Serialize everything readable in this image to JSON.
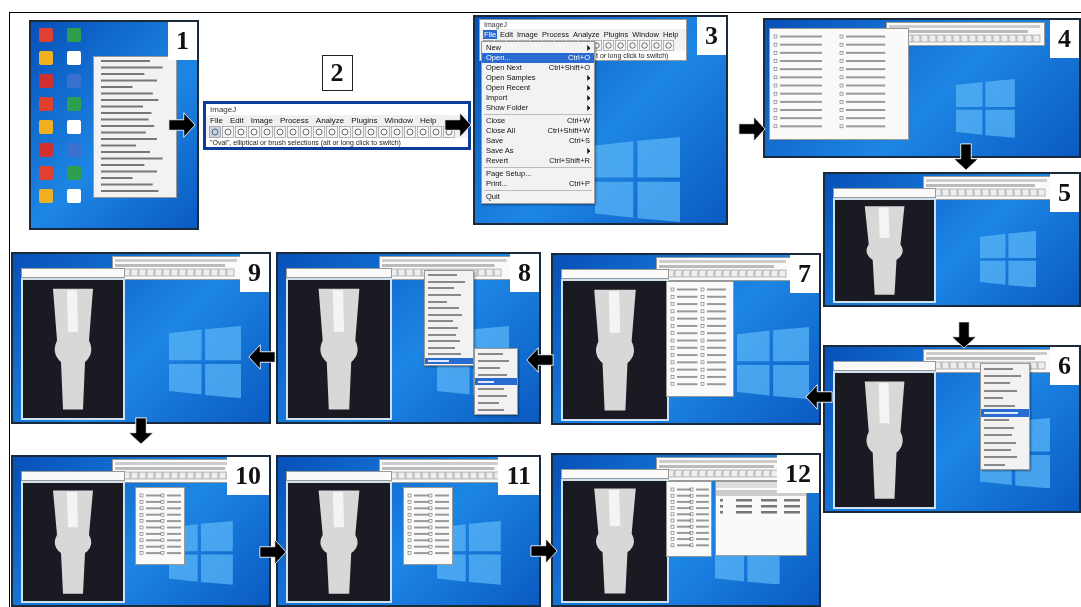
{
  "panels": [
    {
      "number": "1",
      "kind": "context-menu"
    },
    {
      "number": "2",
      "kind": "toolbar",
      "title": "ImageJ",
      "menubar": [
        {
          "label": "File",
          "selected": false
        },
        {
          "label": "Edit",
          "selected": false
        },
        {
          "label": "Image",
          "selected": false
        },
        {
          "label": "Process",
          "selected": false
        },
        {
          "label": "Analyze",
          "selected": false
        },
        {
          "label": "Plugins",
          "selected": false
        },
        {
          "label": "Window",
          "selected": false
        },
        {
          "label": "Help",
          "selected": false
        }
      ],
      "status": "\"Oval\", elliptical or brush selections (alt or long click to switch)"
    },
    {
      "number": "3",
      "kind": "file-menu",
      "title": "ImageJ",
      "menubar": [
        {
          "label": "File",
          "selected": true
        },
        {
          "label": "Edit",
          "selected": false
        },
        {
          "label": "Image",
          "selected": false
        },
        {
          "label": "Process",
          "selected": false
        },
        {
          "label": "Analyze",
          "selected": false
        },
        {
          "label": "Plugins",
          "selected": false
        },
        {
          "label": "Window",
          "selected": false
        },
        {
          "label": "Help",
          "selected": false
        }
      ],
      "status": "t or long click to switch)",
      "menu": [
        {
          "kind": "item",
          "label": "New",
          "submenu": true,
          "selected": false
        },
        {
          "kind": "item",
          "label": "Open...",
          "shortcut": "Ctrl+O",
          "selected": true
        },
        {
          "kind": "item",
          "label": "Open Next",
          "shortcut": "Ctrl+Shift+O",
          "selected": false
        },
        {
          "kind": "item",
          "label": "Open Samples",
          "submenu": true,
          "selected": false
        },
        {
          "kind": "item",
          "label": "Open Recent",
          "submenu": true,
          "selected": false
        },
        {
          "kind": "item",
          "label": "Import",
          "submenu": true,
          "selected": false
        },
        {
          "kind": "item",
          "label": "Show Folder",
          "submenu": true,
          "selected": false
        },
        {
          "kind": "separator"
        },
        {
          "kind": "item",
          "label": "Close",
          "shortcut": "Ctrl+W",
          "selected": false
        },
        {
          "kind": "item",
          "label": "Close All",
          "shortcut": "Ctrl+Shift+W",
          "selected": false
        },
        {
          "kind": "item",
          "label": "Save",
          "shortcut": "Ctrl+S",
          "selected": false
        },
        {
          "kind": "item",
          "label": "Save As",
          "submenu": true,
          "selected": false
        },
        {
          "kind": "item",
          "label": "Revert",
          "shortcut": "Ctrl+Shift+R",
          "selected": false
        },
        {
          "kind": "separator"
        },
        {
          "kind": "item",
          "label": "Page Setup...",
          "selected": false
        },
        {
          "kind": "item",
          "label": "Print...",
          "shortcut": "Ctrl+P",
          "selected": false
        },
        {
          "kind": "separator"
        },
        {
          "kind": "item",
          "label": "Quit",
          "selected": false
        }
      ]
    },
    {
      "number": "4",
      "kind": "open-dialog"
    },
    {
      "number": "5",
      "kind": "image-window"
    },
    {
      "number": "9",
      "kind": "image-window"
    },
    {
      "number": "8",
      "kind": "analyze-menu",
      "menu_rows": [
        {
          "selected": false
        },
        {
          "selected": false
        },
        {
          "selected": false
        },
        {
          "selected": false
        },
        {
          "selected": false
        },
        {
          "selected": false
        },
        {
          "selected": false
        },
        {
          "selected": false
        },
        {
          "selected": false
        },
        {
          "selected": false
        },
        {
          "selected": false
        },
        {
          "selected": false
        },
        {
          "selected": false
        },
        {
          "selected": true
        }
      ],
      "submenu_rows": [
        {
          "selected": false
        },
        {
          "selected": false
        },
        {
          "selected": false
        },
        {
          "selected": false
        },
        {
          "selected": true
        },
        {
          "selected": false
        },
        {
          "selected": false
        },
        {
          "selected": false
        },
        {
          "selected": false
        }
      ]
    },
    {
      "number": "7",
      "kind": "set-measurements"
    },
    {
      "number": "6",
      "kind": "analyze-menu",
      "menu_rows": [
        {
          "selected": false
        },
        {
          "selected": false
        },
        {
          "selected": false
        },
        {
          "selected": false
        },
        {
          "selected": false
        },
        {
          "selected": false
        },
        {
          "selected": true
        },
        {
          "selected": false
        },
        {
          "selected": false
        },
        {
          "selected": false
        },
        {
          "selected": false
        },
        {
          "selected": false
        },
        {
          "selected": false
        },
        {
          "selected": false
        }
      ]
    },
    {
      "number": "10",
      "kind": "roi-manager"
    },
    {
      "number": "11",
      "kind": "roi-manager"
    },
    {
      "number": "12",
      "kind": "results"
    }
  ],
  "arrows": [
    {
      "kind": "right"
    },
    {
      "kind": "right"
    },
    {
      "kind": "right"
    },
    {
      "kind": "down"
    },
    {
      "kind": "down"
    },
    {
      "kind": "left"
    },
    {
      "kind": "left"
    },
    {
      "kind": "left"
    },
    {
      "kind": "down"
    },
    {
      "kind": "right"
    },
    {
      "kind": "right"
    }
  ]
}
